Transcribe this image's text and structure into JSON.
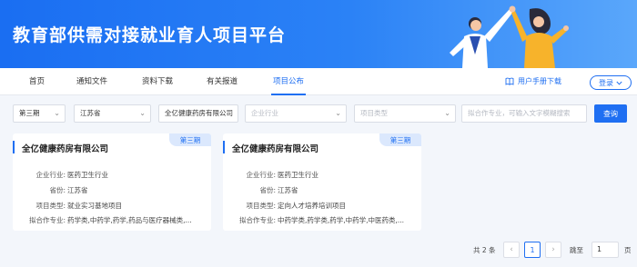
{
  "header": {
    "title": "教育部供需对接就业育人项目平台"
  },
  "nav": {
    "items": [
      "首页",
      "通知文件",
      "资料下载",
      "有关报道",
      "项目公布"
    ],
    "active_index": 4,
    "manual_label": "用户手册下载",
    "login_label": "登录"
  },
  "filters": {
    "batch": "第三期",
    "province": "江苏省",
    "company": "全亿健康药房有限公司",
    "industry_placeholder": "企业行业",
    "type_placeholder": "项目类型",
    "major_placeholder": "拟合作专业，可输入文字模糊搜索",
    "search_label": "查询"
  },
  "cards": [
    {
      "company": "全亿健康药房有限公司",
      "batch_tag": "第三期",
      "industry_label": "企业行业:",
      "industry": "医药卫生行业",
      "province_label": "省份:",
      "province": "江苏省",
      "type_label": "项目类型:",
      "type": "就业实习基地项目",
      "major_label": "拟合作专业:",
      "major": "药学类,中药学,药学,药品与医疗器械类,..."
    },
    {
      "company": "全亿健康药房有限公司",
      "batch_tag": "第三期",
      "industry_label": "企业行业:",
      "industry": "医药卫生行业",
      "province_label": "省份:",
      "province": "江苏省",
      "type_label": "项目类型:",
      "type": "定向人才培养培训项目",
      "major_label": "拟合作专业:",
      "major": "中药学类,药学类,药学,中药学,中医药类,..."
    }
  ],
  "pagination": {
    "total_text": "共 2 条",
    "current_page": "1",
    "jump_label": "跳至",
    "jump_value": "1",
    "page_suffix": "页"
  },
  "colors": {
    "brand": "#1f6ff2",
    "banner_start": "#1a6ef2",
    "banner_end": "#5aa7fb"
  }
}
